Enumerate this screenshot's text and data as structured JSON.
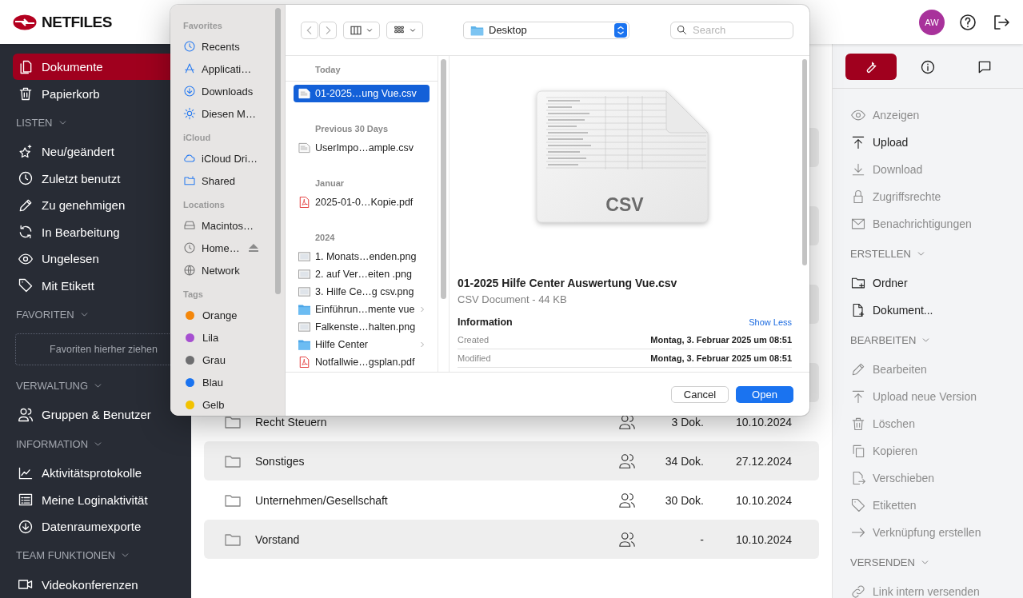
{
  "header": {
    "logo": "NETFILES",
    "avatar": "AW"
  },
  "sidebar": {
    "top": [
      {
        "label": "Dokumente",
        "selected": true
      },
      {
        "label": "Papierkorb",
        "selected": false
      }
    ],
    "sections": [
      {
        "title": "LISTEN",
        "items": [
          {
            "label": "Neu/geändert",
            "selected": false
          },
          {
            "label": "Zuletzt benutzt",
            "selected": false
          },
          {
            "label": "Zu genehmigen",
            "selected": false
          },
          {
            "label": "In Bearbeitung",
            "selected": false
          },
          {
            "label": "Ungelesen",
            "selected": false
          },
          {
            "label": "Mit Etikett",
            "selected": false
          }
        ]
      },
      {
        "title": "FAVORITEN",
        "dropzone": "Favoriten hierher ziehen"
      },
      {
        "title": "VERWALTUNG",
        "items": [
          {
            "label": "Gruppen & Benutzer",
            "selected": false
          }
        ]
      },
      {
        "title": "INFORMATION",
        "items": [
          {
            "label": "Aktivitätsprotokolle",
            "selected": false
          },
          {
            "label": "Meine Loginaktivität",
            "selected": false
          },
          {
            "label": "Datenraumexporte",
            "selected": false
          }
        ]
      },
      {
        "title": "TEAM FUNKTIONEN",
        "items": [
          {
            "label": "Videokonferenzen",
            "selected": false
          }
        ]
      }
    ]
  },
  "documents": {
    "rows": [
      {
        "name": "Recht Steuern",
        "count": "3 Dok.",
        "date": "10.10.2024"
      },
      {
        "name": "Sonstiges",
        "count": "34 Dok.",
        "date": "27.12.2024"
      },
      {
        "name": "Unternehmen/Gesellschaft",
        "count": "30 Dok.",
        "date": "10.10.2024"
      },
      {
        "name": "Vorstand",
        "count": "-",
        "date": "10.10.2024"
      }
    ]
  },
  "panel": {
    "tabs": [
      {
        "selected": true
      },
      {
        "selected": false
      },
      {
        "selected": false
      }
    ],
    "sections": [
      {
        "items": [
          {
            "label": "Anzeigen",
            "disabled": true
          },
          {
            "label": "Upload",
            "disabled": false
          },
          {
            "label": "Download",
            "disabled": true
          },
          {
            "label": "Zugriffsrechte",
            "disabled": true
          },
          {
            "label": "Benachrichtigungen",
            "disabled": true
          }
        ]
      },
      {
        "title": "ERSTELLEN",
        "items": [
          {
            "label": "Ordner",
            "disabled": false
          },
          {
            "label": "Dokument...",
            "disabled": false
          }
        ]
      },
      {
        "title": "BEARBEITEN",
        "items": [
          {
            "label": "Bearbeiten",
            "disabled": true
          },
          {
            "label": "Upload neue Version",
            "disabled": true
          },
          {
            "label": "Löschen",
            "disabled": true
          },
          {
            "label": "Kopieren",
            "disabled": true
          },
          {
            "label": "Verschieben",
            "disabled": true
          },
          {
            "label": "Etiketten",
            "disabled": true
          },
          {
            "label": "Verknüpfung erstellen",
            "disabled": true
          }
        ]
      },
      {
        "title": "VERSENDEN",
        "items": [
          {
            "label": "Link intern versenden",
            "disabled": true
          }
        ]
      }
    ]
  },
  "dialog": {
    "sidebar": [
      {
        "title": "Favorites",
        "items": [
          {
            "label": "Recents"
          },
          {
            "label": "Applicati…"
          },
          {
            "label": "Downloads"
          },
          {
            "label": "Diesen M…"
          }
        ]
      },
      {
        "title": "iCloud",
        "items": [
          {
            "label": "iCloud Dri…"
          },
          {
            "label": "Shared"
          }
        ]
      },
      {
        "title": "Locations",
        "items": [
          {
            "label": "Macintos…",
            "eject": false
          },
          {
            "label": "Home…",
            "eject": true
          },
          {
            "label": "Network",
            "eject": false
          }
        ]
      },
      {
        "title": "Tags",
        "items": [
          {
            "label": "Orange",
            "color": "#f4870b"
          },
          {
            "label": "Lila",
            "color": "#a64fd0"
          },
          {
            "label": "Grau",
            "color": "#6e6e70"
          },
          {
            "label": "Blau",
            "color": "#1a73f0"
          },
          {
            "label": "Gelb",
            "color": "#f2c200"
          }
        ]
      }
    ],
    "location": "Desktop",
    "search_placeholder": "Search",
    "files": [
      {
        "group": "Today",
        "items": [
          {
            "name": "01-2025…ung Vue.csv",
            "kind": "csv",
            "selected": true
          }
        ]
      },
      {
        "group": "Previous 30 Days",
        "items": [
          {
            "name": "UserImpo…ample.csv",
            "kind": "csv",
            "selected": false
          }
        ]
      },
      {
        "group": "Januar",
        "items": [
          {
            "name": "2025-01-0…Kopie.pdf",
            "kind": "pdf",
            "selected": false
          }
        ]
      },
      {
        "group": "2024",
        "items": [
          {
            "name": "1. Monats…enden.png",
            "kind": "png",
            "selected": false
          },
          {
            "name": "2. auf Ver…eiten .png",
            "kind": "png",
            "selected": false
          },
          {
            "name": "3. Hilfe Ce…g csv.png",
            "kind": "png",
            "selected": false
          },
          {
            "name": "Einführun…mente vue",
            "kind": "folder",
            "selected": false
          },
          {
            "name": "Falkenste…halten.png",
            "kind": "png",
            "selected": false
          },
          {
            "name": "Hilfe Center",
            "kind": "folder",
            "selected": false
          },
          {
            "name": "Notfallwie…gsplan.pdf",
            "kind": "pdf",
            "selected": false
          }
        ]
      }
    ],
    "preview": {
      "badge": "CSV",
      "name": "01-2025 Hilfe Center Auswertung Vue.csv",
      "subtitle": "CSV Document - 44 KB",
      "info_title": "Information",
      "toggle": "Show Less",
      "rows": [
        {
          "label": "Created",
          "value": "Montag, 3. Februar 2025 um 08:51"
        },
        {
          "label": "Modified",
          "value": "Montag, 3. Februar 2025 um 08:51"
        }
      ]
    },
    "buttons": {
      "cancel": "Cancel",
      "open": "Open"
    }
  }
}
